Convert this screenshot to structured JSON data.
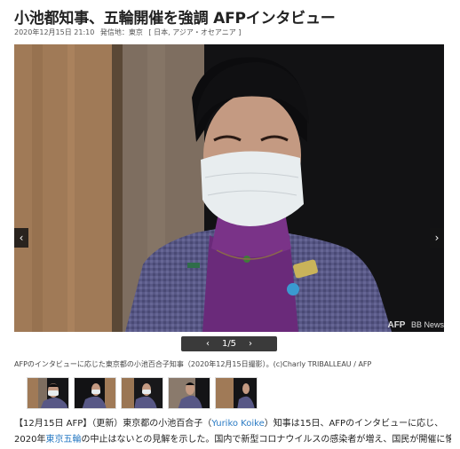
{
  "article": {
    "headline": "小池都知事、五輪開催を強調 AFPインタビュー",
    "date": "2020年12月15日 21:10",
    "origin_label": "発信地：東京",
    "categories_open": "[",
    "category_1": "日本",
    "category_2": "アジア・オセアニア",
    "categories_close": "]"
  },
  "gallery": {
    "prev_arrow": "‹",
    "next_arrow": "›",
    "pager_prev": "‹",
    "pager_text": "1/5",
    "pager_next": "›",
    "watermark_afp": "AFP",
    "watermark_bb": "BB News",
    "caption": "AFPのインタビューに応じた東京都の小池百合子知事（2020年12月15日撮影）。(c)Charly TRIBALLEAU / AFP"
  },
  "body": {
    "p1_a": "【12月15日 AFP】（更新）東京都の小池百合子（",
    "p1_link": "Yuriko Koike",
    "p1_b": "）知事は15日、AFPのインタビューに応じ、",
    "p2_a": "2020年",
    "p2_link": "東京五輪",
    "p2_b": "の中止はないとの見解を示した。国内で新型コロナウイルスの感染者が増え、国民が開催に懐疑的"
  },
  "colors": {
    "link": "#2a7bc4",
    "jacket": "#5b5a86",
    "sweater": "#6a2a7a",
    "mask": "#e9eef0"
  }
}
